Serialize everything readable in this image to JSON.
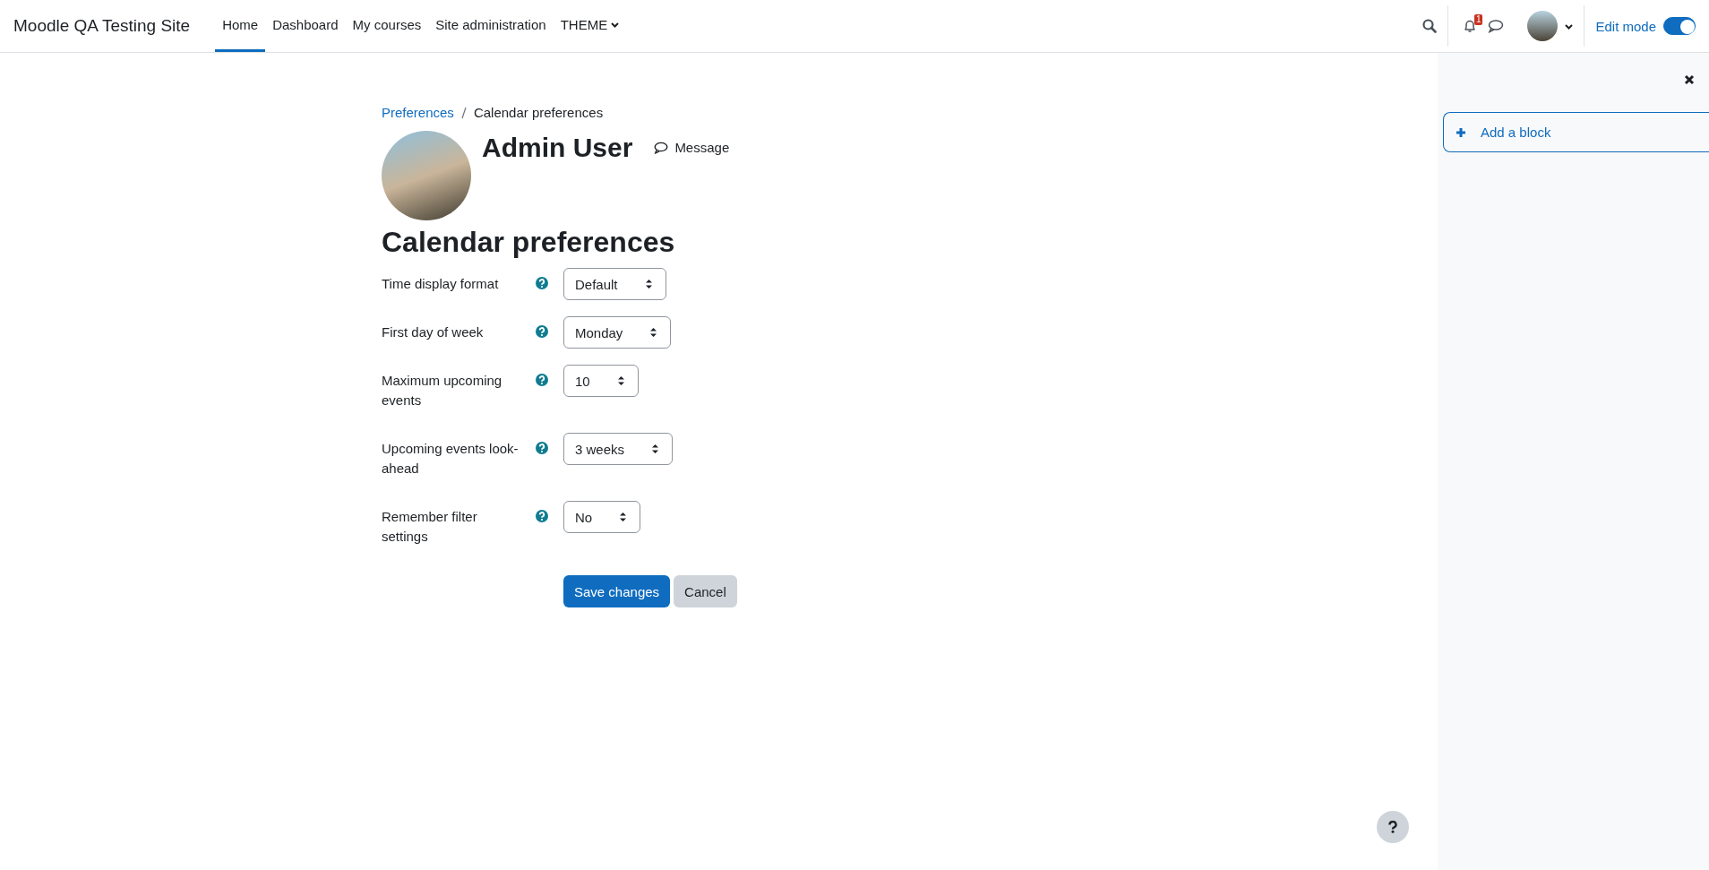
{
  "site_name": "Moodle QA Testing Site",
  "nav": [
    {
      "label": "Home",
      "selected": true,
      "dropdown": false
    },
    {
      "label": "Dashboard",
      "selected": false,
      "dropdown": false
    },
    {
      "label": "My courses",
      "selected": false,
      "dropdown": false
    },
    {
      "label": "Site administration",
      "selected": false,
      "dropdown": false
    },
    {
      "label": "THEME",
      "selected": false,
      "dropdown": true
    }
  ],
  "notifications": {
    "count": "1"
  },
  "edit_mode": {
    "label": "Edit mode",
    "on": true
  },
  "breadcrumb": [
    {
      "label": "Preferences",
      "kind": "link"
    },
    {
      "label": "Calendar preferences",
      "kind": "current"
    }
  ],
  "profile": {
    "name": "Admin User",
    "message": "Message"
  },
  "heading": "Calendar preferences",
  "fields": [
    {
      "label": "Time display format",
      "value": "Default"
    },
    {
      "label": "First day of week",
      "value": "Monday"
    },
    {
      "label": "Maximum upcoming events",
      "value": "10"
    },
    {
      "label": "Upcoming events look-ahead",
      "value": "3 weeks"
    },
    {
      "label": "Remember filter settings",
      "value": "No"
    }
  ],
  "buttons": [
    {
      "label": "Save changes",
      "kind": "primary"
    },
    {
      "label": "Cancel",
      "kind": "secondary"
    }
  ],
  "drawer": {
    "add_block": "Add a block"
  }
}
